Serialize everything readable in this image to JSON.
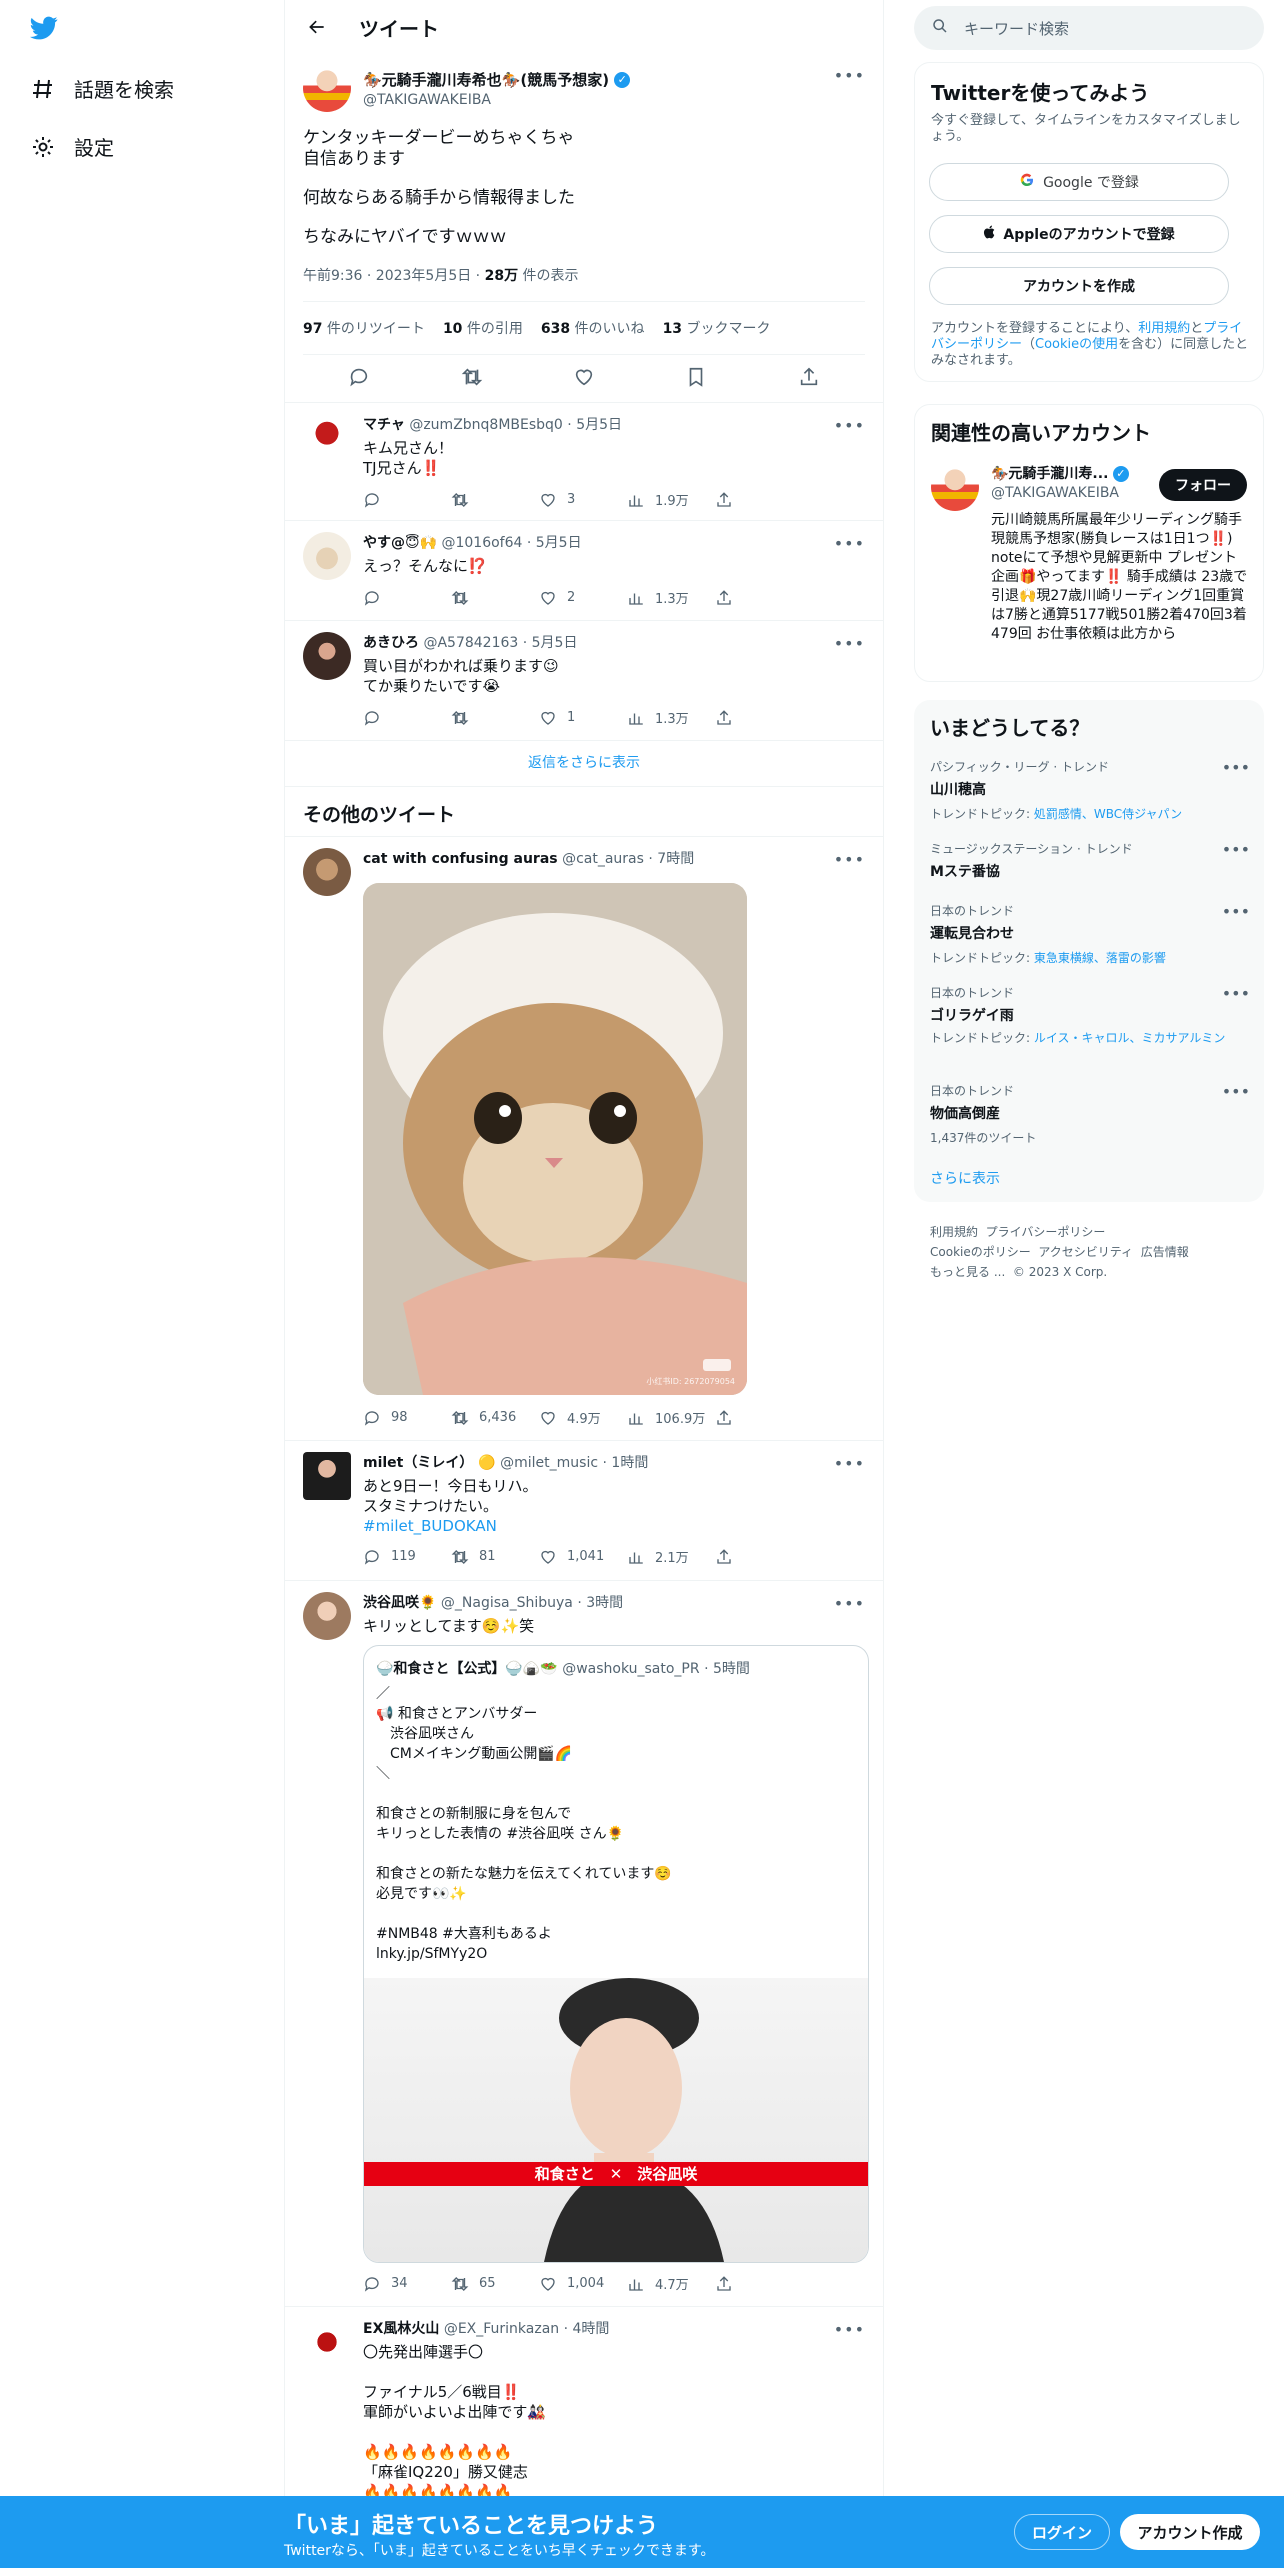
{
  "nav": {
    "explore": "話題を検索",
    "settings": "設定"
  },
  "header": {
    "title": "ツイート"
  },
  "main_tweet": {
    "name": "🏇元騎手瀧川寿希也🏇(競馬予想家)",
    "handle": "@TAKIGAWAKEIBA",
    "lines": [
      "ケンタッキーダービーめちゃくちゃ",
      "自信あります",
      "何故ならある騎手から情報得ました",
      "ちなみにヤバイですｗｗｗ"
    ],
    "time": "午前9:36 · 2023年5月5日 · ",
    "views_num": "28万",
    "views_label": " 件の表示",
    "retweets_num": "97",
    "retweets_label": " 件のリツイート",
    "quotes_num": "10",
    "quotes_label": " 件の引用",
    "likes_num": "638",
    "likes_label": " 件のいいね",
    "bookmarks_num": "13",
    "bookmarks_label": " ブックマーク"
  },
  "replies": [
    {
      "name": "マチャ",
      "handle": "@zumZbnq8MBEsbq0",
      "date": "· 5月5日",
      "lines": [
        "キム兄さん！",
        "TJ兄さん‼️"
      ],
      "reply": "",
      "rt": "",
      "like": "3",
      "views": "1.9万"
    },
    {
      "name": "やす@😇🙌",
      "handle": "@1016of64",
      "date": "· 5月5日",
      "lines": [
        "えっ？そんなに⁉️"
      ],
      "reply": "",
      "rt": "",
      "like": "2",
      "views": "1.3万"
    },
    {
      "name": "あきひろ",
      "handle": "@A57842163",
      "date": "· 5月5日",
      "lines": [
        "買い目がわかれば乗ります😉",
        "てか乗りたいです😭"
      ],
      "reply": "",
      "rt": "",
      "like": "1",
      "views": "1.3万"
    }
  ],
  "show_more_replies": "返信をさらに表示",
  "other_title": "その他のツイート",
  "tweets": [
    {
      "name": "cat with confusing auras",
      "handle": "@cat_auras",
      "date": "· 7時間",
      "reply": "98",
      "rt": "6,436",
      "like": "4.9万",
      "views": "106.9万",
      "watermark": "小红书ID: 2672079054"
    },
    {
      "name": "milet（ミレイ） 🟡",
      "handle": "@milet_music",
      "date": "· 1時間",
      "lines": [
        "あと9日ー！今日もリハ。",
        "スタミナつけたい。"
      ],
      "hashtag": "#milet_BUDOKAN",
      "reply": "119",
      "rt": "81",
      "like": "1,041",
      "views": "2.1万"
    },
    {
      "name": "渋谷凪咲🌻",
      "handle": "@_Nagisa_Shibuya",
      "date": "· 3時間",
      "lines": [
        "キリッとしてます☺️✨笑"
      ],
      "reply": "34",
      "rt": "65",
      "like": "1,004",
      "views": "4.7万"
    },
    {
      "name": "EX風林火山",
      "handle": "@EX_Furinkazan",
      "date": "· 4時間",
      "lines": [
        "〇先発出陣選手〇",
        "",
        "ファイナル5／6戦目‼️",
        "軍師がいよいよ出陣です🎎",
        "",
        "🔥🔥🔥🔥🔥🔥🔥🔥",
        "「麻雀IQ220」勝又健志",
        "🔥🔥🔥🔥🔥🔥🔥🔥"
      ]
    }
  ],
  "quote": {
    "name": "🍚和食さと【公式】🍚🍙🥗",
    "handle": "@washoku_sato_PR",
    "date": "· 5時間",
    "lines": [
      "／",
      "📢 和食さとアンバサダー",
      "　渋谷凪咲さん",
      "　CMメイキング動画公開🎬🌈",
      "＼",
      "",
      "和食さとの新制服に身を包んで",
      "キリっとした表情の #渋谷凪咲 さん🌻",
      "",
      "和食さとの新たな魅力を伝えてくれています☺️",
      "必見です👀✨",
      "",
      "#NMB48 #大喜利もあるよ",
      " lnky.jp/SfMYy2O"
    ],
    "banner": "和食さと　✕　渋谷凪咲"
  },
  "search": {
    "placeholder": "キーワード検索"
  },
  "signup": {
    "title": "Twitterを使ってみよう",
    "desc": "今すぐ登録して、タイムラインをカスタマイズしましょう。",
    "google": "Google で登録",
    "apple": "Appleのアカウントで登録",
    "create": "アカウントを作成",
    "terms_pre": "アカウントを登録することにより、",
    "terms_link1": "利用規約",
    "terms_and": "と",
    "terms_link2": "プライバシーポリシー",
    "terms_paren": "（",
    "terms_link3": "Cookieの使用",
    "terms_post": "を含む）に同意したとみなされます。"
  },
  "related": {
    "title": "関連性の高いアカウント",
    "name": "🏇元騎手瀧川寿...",
    "handle": "@TAKIGAWAKEIBA",
    "follow": "フォロー",
    "bio": "元川崎競馬所属最年少リーディング騎手 現競馬予想家(勝負レースは1日1つ‼️) noteにて予想や見解更新中 プレゼント企画🎁やってます‼️ 騎手成績は 23歳で引退🙌現27歳川崎リーディング1回重賞は7勝と通算5177戦501勝2着470回3着479回 お仕事依頼は此方から"
  },
  "trends": {
    "title": "いまどうしてる？",
    "items": [
      {
        "cat": "パシフィック・リーグ · トレンド",
        "title": "山川穂高",
        "sub_label": "トレンドトピック: ",
        "sub_link": "処罰感情、WBC侍ジャパン"
      },
      {
        "cat": "ミュージックステーション · トレンド",
        "title": "Mステ番協",
        "sub_label": "",
        "sub_link": ""
      },
      {
        "cat": "日本のトレンド",
        "title": "運転見合わせ",
        "sub_label": "トレンドトピック: ",
        "sub_link": "東急東横線、落雷の影響"
      },
      {
        "cat": "日本のトレンド",
        "title": "ゴリラゲイ雨",
        "sub_label": "トレンドトピック: ",
        "sub_link": "ルイス・キャロル、ミカサアルミン"
      },
      {
        "cat": "日本のトレンド",
        "title": "物価高倒産",
        "sub_label": "1,437件のツイート",
        "sub_link": ""
      }
    ],
    "more": "さらに表示"
  },
  "footer": {
    "l1a": "利用規約",
    "l1b": "プライバシーポリシー",
    "l2a": "Cookieのポリシー",
    "l2b": "アクセシビリティ",
    "l2c": "広告情報",
    "l3a": "もっと見る ...",
    "l3b": "© 2023 X Corp."
  },
  "bottom": {
    "title": "「いま」起きていることを見つけよう",
    "sub": "Twitterなら、「いま」起きていることをいち早くチェックできます。",
    "login": "ログイン",
    "signup": "アカウント作成"
  },
  "colors": {
    "accent": "#1d9bf0",
    "text": "#0f1419",
    "muted": "#536471"
  }
}
